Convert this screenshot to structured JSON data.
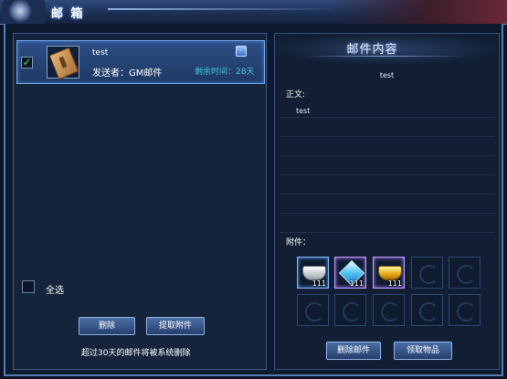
{
  "window": {
    "title": "邮 箱"
  },
  "mail_list": {
    "items": [
      {
        "subject": "test",
        "sender_label": "发送者：GM邮件",
        "remaining_time": "剩余时间：28天",
        "checked": true,
        "icon": "scroll-icon"
      }
    ],
    "select_all_label": "全选",
    "delete_button": "删除",
    "take_attachment_button": "提取附件",
    "notice": "超过30天的邮件将被系统删除"
  },
  "mail_content": {
    "header": "邮件内容",
    "subject": "test",
    "body_label": "正文:",
    "body_text": "test",
    "attachments_label": "附件：",
    "attachments": [
      {
        "icon": "silver-ingot-icon",
        "quantity": "111"
      },
      {
        "icon": "diamond-icon",
        "quantity": "111"
      },
      {
        "icon": "gold-ingot-icon",
        "quantity": "111"
      }
    ],
    "delete_mail_button": "删除邮件",
    "get_items_button": "领取物品"
  },
  "colors": {
    "remaining_time": "#49c6d8",
    "checkmark": "#41d84a",
    "selected_row": "#2d4f86"
  }
}
